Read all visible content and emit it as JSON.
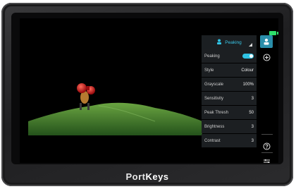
{
  "brand": {
    "logo_prefix": "Port",
    "logo_suffix": "Keys"
  },
  "header": {
    "menu_title": "Peaking"
  },
  "settings": [
    {
      "name": "peaking",
      "label": "Peaking",
      "value": "",
      "type": "toggle",
      "on": true
    },
    {
      "name": "style",
      "label": "Style",
      "value": "Colour"
    },
    {
      "name": "grayscale",
      "label": "Grayscale",
      "value": "100%"
    },
    {
      "name": "sensitivity",
      "label": "Sensitivity",
      "value": "3"
    },
    {
      "name": "peak-thresh",
      "label": "Peak Thresh",
      "value": "50"
    },
    {
      "name": "brightness",
      "label": "Brightness",
      "value": "3"
    },
    {
      "name": "contrast",
      "label": "Contrast",
      "value": "3"
    }
  ],
  "colors": {
    "accent": "#2fc3e4",
    "leaf": "#3f7d2e"
  },
  "icons": {
    "record": "record-icon",
    "battery": "battery-icon",
    "person": "person-icon",
    "add": "plus-circle-icon",
    "help": "help-circle-icon",
    "sliders": "sliders-icon"
  }
}
